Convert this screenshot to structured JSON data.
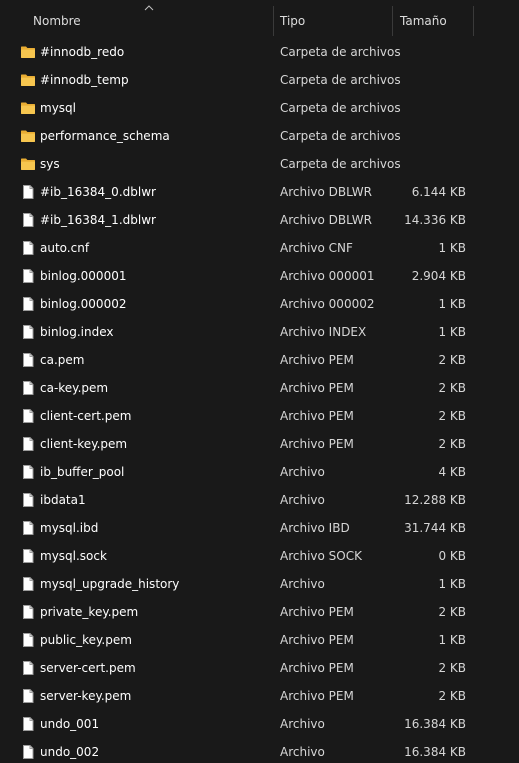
{
  "columns": {
    "name": "Nombre",
    "type": "Tipo",
    "size": "Tamaño"
  },
  "colors": {
    "background": "#191919",
    "folder": "#f4c04a",
    "text": "#ffffff"
  },
  "files": [
    {
      "name": "#innodb_redo",
      "type": "Carpeta de archivos",
      "size": "",
      "icon": "folder-icon"
    },
    {
      "name": "#innodb_temp",
      "type": "Carpeta de archivos",
      "size": "",
      "icon": "folder-icon"
    },
    {
      "name": "mysql",
      "type": "Carpeta de archivos",
      "size": "",
      "icon": "folder-icon"
    },
    {
      "name": "performance_schema",
      "type": "Carpeta de archivos",
      "size": "",
      "icon": "folder-icon"
    },
    {
      "name": "sys",
      "type": "Carpeta de archivos",
      "size": "",
      "icon": "folder-icon"
    },
    {
      "name": "#ib_16384_0.dblwr",
      "type": "Archivo DBLWR",
      "size": "6.144 KB",
      "icon": "file-icon"
    },
    {
      "name": "#ib_16384_1.dblwr",
      "type": "Archivo DBLWR",
      "size": "14.336 KB",
      "icon": "file-icon"
    },
    {
      "name": "auto.cnf",
      "type": "Archivo CNF",
      "size": "1 KB",
      "icon": "file-icon"
    },
    {
      "name": "binlog.000001",
      "type": "Archivo 000001",
      "size": "2.904 KB",
      "icon": "file-icon"
    },
    {
      "name": "binlog.000002",
      "type": "Archivo 000002",
      "size": "1 KB",
      "icon": "file-icon"
    },
    {
      "name": "binlog.index",
      "type": "Archivo INDEX",
      "size": "1 KB",
      "icon": "file-icon"
    },
    {
      "name": "ca.pem",
      "type": "Archivo PEM",
      "size": "2 KB",
      "icon": "file-icon"
    },
    {
      "name": "ca-key.pem",
      "type": "Archivo PEM",
      "size": "2 KB",
      "icon": "file-icon"
    },
    {
      "name": "client-cert.pem",
      "type": "Archivo PEM",
      "size": "2 KB",
      "icon": "file-icon"
    },
    {
      "name": "client-key.pem",
      "type": "Archivo PEM",
      "size": "2 KB",
      "icon": "file-icon"
    },
    {
      "name": "ib_buffer_pool",
      "type": "Archivo",
      "size": "4 KB",
      "icon": "file-icon"
    },
    {
      "name": "ibdata1",
      "type": "Archivo",
      "size": "12.288 KB",
      "icon": "file-icon"
    },
    {
      "name": "mysql.ibd",
      "type": "Archivo IBD",
      "size": "31.744 KB",
      "icon": "file-icon"
    },
    {
      "name": "mysql.sock",
      "type": "Archivo SOCK",
      "size": "0 KB",
      "icon": "file-icon"
    },
    {
      "name": "mysql_upgrade_history",
      "type": "Archivo",
      "size": "1 KB",
      "icon": "file-icon"
    },
    {
      "name": "private_key.pem",
      "type": "Archivo PEM",
      "size": "2 KB",
      "icon": "file-icon"
    },
    {
      "name": "public_key.pem",
      "type": "Archivo PEM",
      "size": "1 KB",
      "icon": "file-icon"
    },
    {
      "name": "server-cert.pem",
      "type": "Archivo PEM",
      "size": "2 KB",
      "icon": "file-icon"
    },
    {
      "name": "server-key.pem",
      "type": "Archivo PEM",
      "size": "2 KB",
      "icon": "file-icon"
    },
    {
      "name": "undo_001",
      "type": "Archivo",
      "size": "16.384 KB",
      "icon": "file-icon"
    },
    {
      "name": "undo_002",
      "type": "Archivo",
      "size": "16.384 KB",
      "icon": "file-icon"
    }
  ]
}
